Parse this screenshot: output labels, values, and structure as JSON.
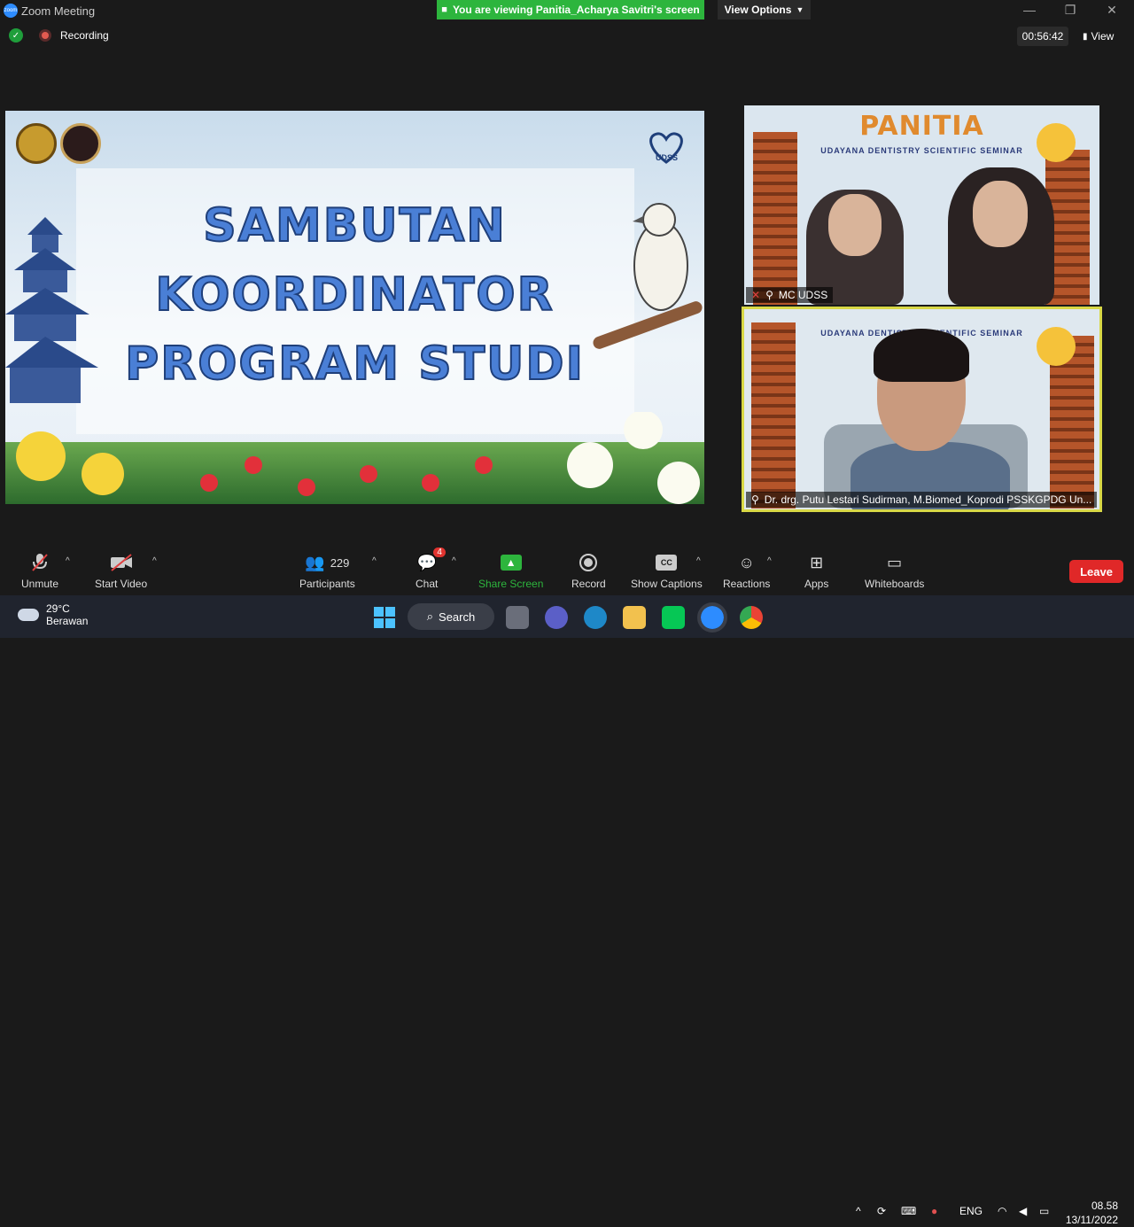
{
  "window": {
    "title": "Zoom Meeting"
  },
  "banner": {
    "text": "You are viewing Panitia_Acharya Savitri's screen"
  },
  "view_options": {
    "label": "View Options"
  },
  "status": {
    "recording_label": "Recording",
    "timer": "00:56:42",
    "view_label": "View"
  },
  "shared_slide": {
    "lines": [
      "SAMBUTAN",
      "KOORDINATOR",
      "PROGRAM STUDI"
    ],
    "logo_text": "UDSS"
  },
  "video_tiles": [
    {
      "name": "MC UDSS",
      "heading": "PANITIA",
      "subtitle": "UDAYANA DENTISTRY SCIENTIFIC SEMINAR"
    },
    {
      "name": "Dr. drg. Putu Lestari Sudirman, M.Biomed_Koprodi PSSKGPDG Un...",
      "subtitle": "UDAYANA DENTISTRY SCIENTIFIC SEMINAR"
    }
  ],
  "toolbar": {
    "unmute": "Unmute",
    "start_video": "Start Video",
    "participants": "Participants",
    "participants_count": "229",
    "chat": "Chat",
    "chat_badge": "4",
    "share_screen": "Share Screen",
    "record": "Record",
    "show_captions": "Show Captions",
    "reactions": "Reactions",
    "apps": "Apps",
    "whiteboards": "Whiteboards",
    "leave": "Leave"
  },
  "taskbar": {
    "temperature": "29°C",
    "weather": "Berawan",
    "search": "Search",
    "language": "ENG",
    "time": "08.58",
    "date": "13/11/2022"
  },
  "colors": {
    "accent_green": "#2db53d",
    "leave_red": "#e02828",
    "active_speaker": "#d8d846"
  }
}
